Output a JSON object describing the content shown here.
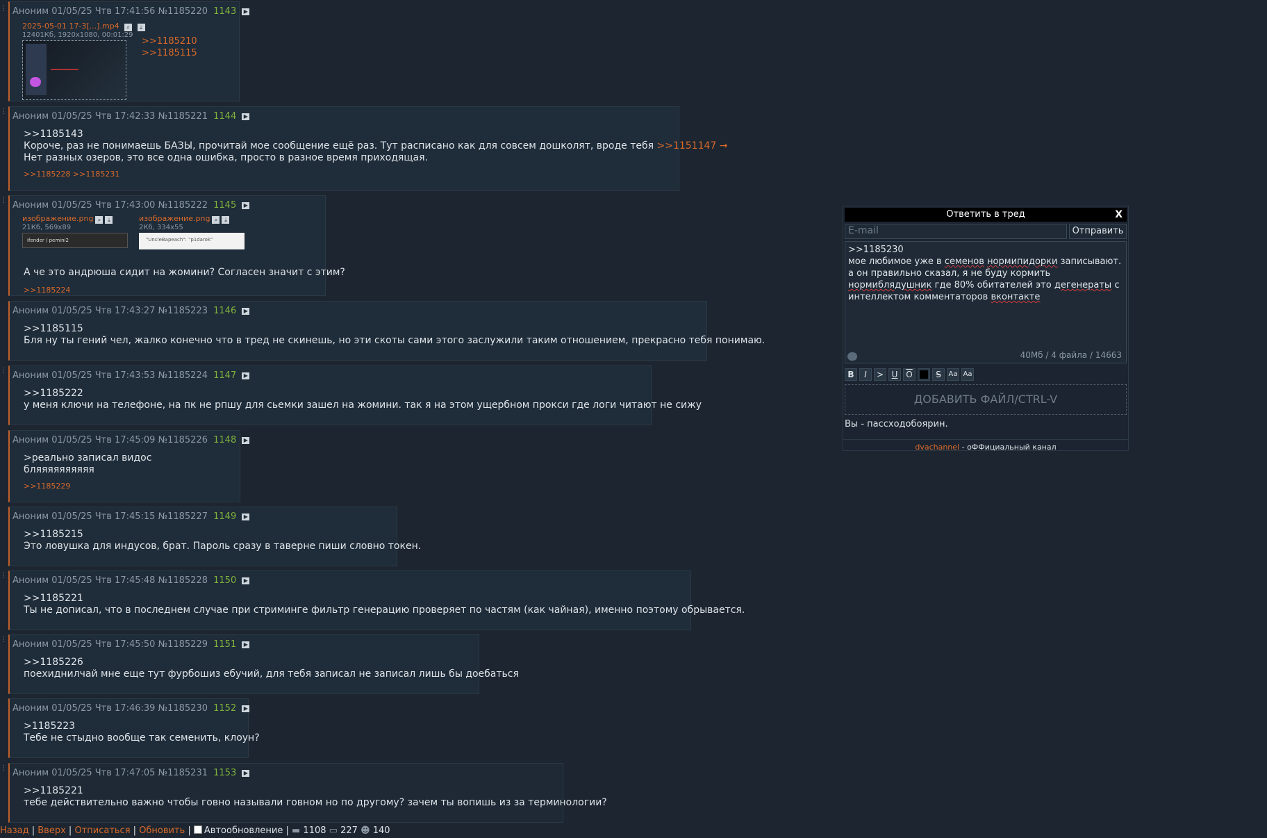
{
  "posts": [
    {
      "author": "Аноним",
      "date": "01/05/25 Чтв 17:41:56",
      "id": "№1185220",
      "num": "1143",
      "file": {
        "name": "2025-05-01 17-3[...].mp4",
        "meta": "12401Кб, 1920x1080, 00:01:29"
      },
      "quotes": [
        ">>1185210",
        ">>1185115"
      ]
    },
    {
      "author": "Аноним",
      "date": "01/05/25 Чтв 17:42:33",
      "id": "№1185221",
      "num": "1144",
      "lines": [
        ">>1185143",
        "Короче, раз не понимаешь БАЗЫ, прочитай мое сообщение ещё раз. Тут расписано как для совсем дошколят, вроде тебя",
        ">>1151147 →",
        "Нет разных озеров, это все одна ошибка, просто в разное время приходящая."
      ],
      "replies": ">>1185228 >>1185231"
    },
    {
      "author": "Аноним",
      "date": "01/05/25 Чтв 17:43:00",
      "id": "№1185222",
      "num": "1145",
      "files": [
        {
          "name": "изображение.png",
          "meta": "21Кб, 569x89",
          "thumb_text": "ifender / pemini2"
        },
        {
          "name": "изображение.png",
          "meta": "2Кб, 334x55",
          "thumb_text": "\"UncleBapeach\": \"p1darok\""
        }
      ],
      "lines": [
        "А че это андрюша сидит на жомини? Согласен значит с этим?"
      ],
      "replies": ">>1185224"
    },
    {
      "author": "Аноним",
      "date": "01/05/25 Чтв 17:43:27",
      "id": "№1185223",
      "num": "1146",
      "lines": [
        ">>1185115",
        "Бля ну ты гений чел, жалко конечно что в тред не скинешь, но эти скоты сами этого заслужили таким отношением, прекрасно тебя понимаю."
      ]
    },
    {
      "author": "Аноним",
      "date": "01/05/25 Чтв 17:43:53",
      "id": "№1185224",
      "num": "1147",
      "lines": [
        ">>1185222",
        "у меня ключи на телефоне, на пк не рпшу для сьемки зашел на жомини. так я на этом ущербном прокси где логи читают не сижу"
      ]
    },
    {
      "author": "Аноним",
      "date": "01/05/25 Чтв 17:45:09",
      "id": "№1185226",
      "num": "1148",
      "lines": [
        ">реально записал видос",
        "бляяяяяяяяяя"
      ],
      "replies": ">>1185229"
    },
    {
      "author": "Аноним",
      "date": "01/05/25 Чтв 17:45:15",
      "id": "№1185227",
      "num": "1149",
      "lines": [
        ">>1185215",
        "Это ловушка для индусов, брат. Пароль сразу в таверне пиши словно токен."
      ]
    },
    {
      "author": "Аноним",
      "date": "01/05/25 Чтв 17:45:48",
      "id": "№1185228",
      "num": "1150",
      "lines": [
        ">>1185221",
        "Ты не дописал, что в последнем случае при стриминге фильтр генерацию проверяет по частям (как чайная), именно поэтому обрывается."
      ]
    },
    {
      "author": "Аноним",
      "date": "01/05/25 Чтв 17:45:50",
      "id": "№1185229",
      "num": "1151",
      "lines": [
        ">>1185226",
        "поехиднилчай мне еще тут фурбошиз ебучий, для тебя записал не записал лишь бы доебаться"
      ]
    },
    {
      "author": "Аноним",
      "date": "01/05/25 Чтв 17:46:39",
      "id": "№1185230",
      "num": "1152",
      "lines": [
        ">1185223",
        "Тебе не стыдно вообще так семенить, клоун?"
      ]
    },
    {
      "author": "Аноним",
      "date": "01/05/25 Чтв 17:47:05",
      "id": "№1185231",
      "num": "1153",
      "lines": [
        ">>1185221",
        "тебе действительно важно чтобы говно называли говном но по другому? зачем ты вопишь из за терминологии?"
      ]
    }
  ],
  "reply_form": {
    "title": "Ответить в тред",
    "close": "X",
    "email_placeholder": "E-mail",
    "send_label": "Отправить",
    "message_lines": [
      ">>1185230",
      "мое любимое уже в семенов нормипидорки записывают.",
      "а он правильно сказал, я не буду кормить",
      "нормиблядушник где 80% обитателей это дегенераты с",
      "интеллектом комментаторов вконтакте"
    ],
    "counter": "40Мб / 4 файла / 14663",
    "toolbar": [
      "B",
      "I",
      ">",
      "U",
      "O",
      "",
      "S",
      "Aa",
      "Aa"
    ],
    "drop_label": "ДОБАВИТЬ ФАЙЛ/CTRL-V",
    "note": "Вы - пассходобоярин.",
    "footer_link": "dvachannel",
    "footer_text": " - оФФициальный канал"
  },
  "bottom_bar": {
    "back": "Назад",
    "up": "Вверх",
    "unsubscribe": "Отписаться",
    "refresh": "Обновить",
    "autorefresh": "Автообновление",
    "posts": "1108",
    "files": "227",
    "users": "140"
  }
}
